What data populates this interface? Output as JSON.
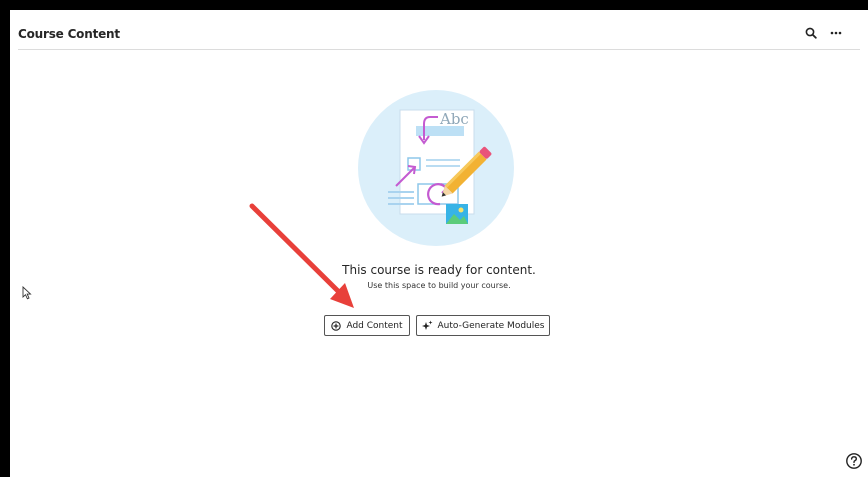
{
  "header": {
    "title": "Course Content",
    "icons": [
      "search-icon",
      "more-options-icon"
    ]
  },
  "empty_state": {
    "illustration_text": "Abc",
    "title": "This course is ready for content.",
    "subtitle": "Use this space to build your course."
  },
  "actions": {
    "add_content_label": "Add Content",
    "auto_generate_label": "Auto-Generate Modules"
  },
  "colors": {
    "annotation_arrow": "#e8403a",
    "illustration_bg": "#dbeffa",
    "accent_purple": "#c45bd1",
    "pencil": "#f2b233"
  }
}
